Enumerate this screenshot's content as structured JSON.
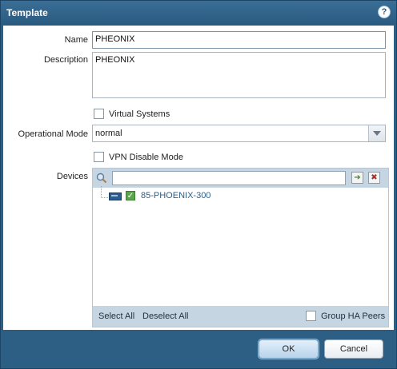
{
  "dialog": {
    "title": "Template",
    "help_icon": "?"
  },
  "form": {
    "name_label": "Name",
    "name_value": "PHEONIX",
    "description_label": "Description",
    "description_value": "PHEONIX",
    "virtual_systems_label": "Virtual Systems",
    "virtual_systems_checked": false,
    "operational_mode_label": "Operational Mode",
    "operational_mode_value": "normal",
    "vpn_disable_label": "VPN Disable Mode",
    "vpn_disable_checked": false,
    "devices_label": "Devices"
  },
  "devices": {
    "search_placeholder": "",
    "go_button_glyph": "➔",
    "clear_button_glyph": "✖",
    "items": [
      {
        "name": "85-PHOENIX-300",
        "checked": true
      }
    ],
    "select_all_label": "Select All",
    "deselect_all_label": "Deselect All",
    "group_ha_label": "Group HA Peers",
    "group_ha_checked": false
  },
  "buttons": {
    "ok_label": "OK",
    "cancel_label": "Cancel"
  },
  "colors": {
    "titlebar": "#2d5f85",
    "panel_bg": "#ffffff",
    "toolbar_bg": "#c6d5e2",
    "device_text": "#2d5f85"
  }
}
